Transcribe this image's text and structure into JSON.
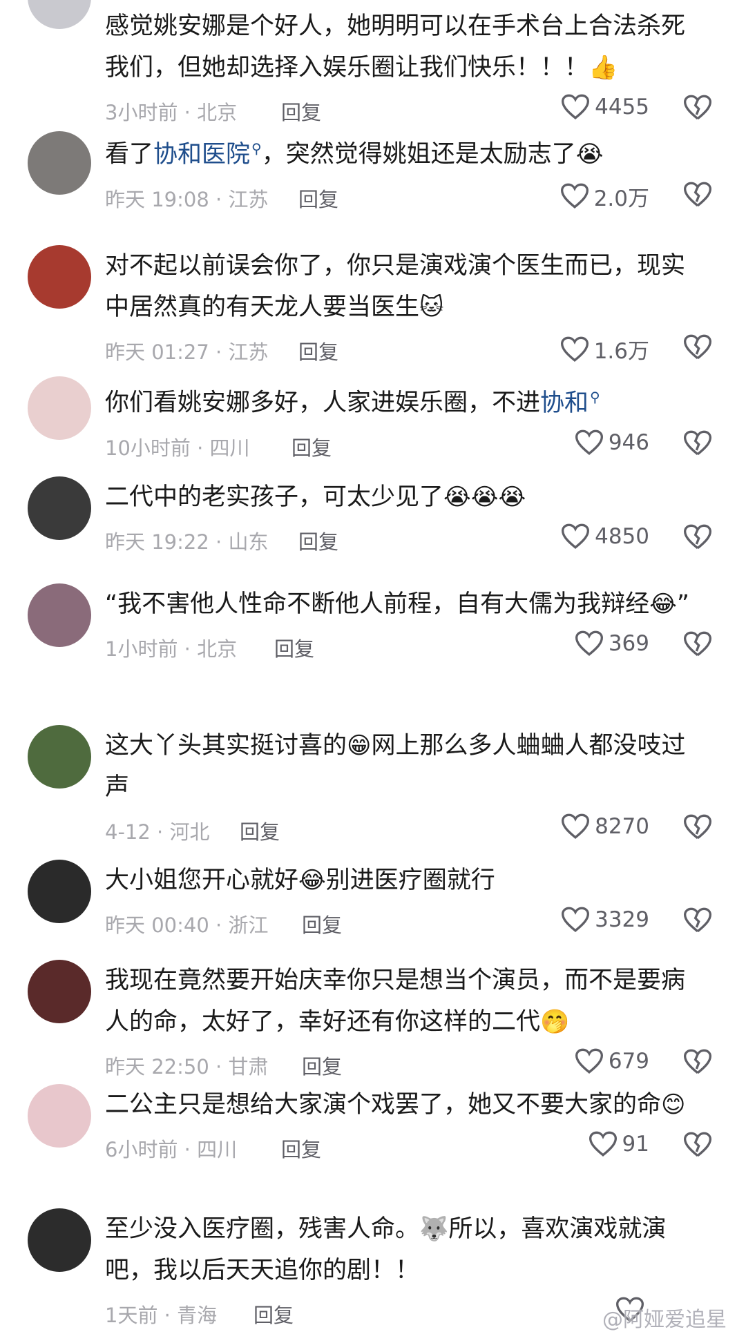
{
  "comments": [
    {
      "text_parts": [
        {
          "t": "感觉姚安娜是个好人，她明明可以在手术台上合法杀死我们，但她却选择入娱乐圈让我们快乐！！！"
        },
        {
          "e": "👍"
        }
      ],
      "time": "3小时前 · 北京",
      "reply": "回复",
      "likes": "4455",
      "avatar_color": "#c9c9cf"
    },
    {
      "text_parts": [
        {
          "t": "看了"
        },
        {
          "k": "协和医院"
        },
        {
          "t": "，突然觉得姚姐还是太励志了"
        },
        {
          "e": "😭"
        }
      ],
      "time": "昨天 19:08 · 江苏",
      "reply": "回复",
      "likes": "2.0万",
      "avatar_color": "#7d7a78"
    },
    {
      "text_parts": [
        {
          "t": "对不起以前误会你了，你只是演戏演个医生而已，现实中居然真的有天龙人要当医生"
        },
        {
          "e": "🐱"
        }
      ],
      "time": "昨天 01:27 · 江苏",
      "reply": "回复",
      "likes": "1.6万",
      "avatar_color": "#a73a2f"
    },
    {
      "text_parts": [
        {
          "t": "你们看姚安娜多好，人家进娱乐圈，不进"
        },
        {
          "k": "协和"
        }
      ],
      "time": "10小时前 · 四川",
      "reply": "回复",
      "likes": "946",
      "avatar_color": "#e9cfcf"
    },
    {
      "text_parts": [
        {
          "t": "二代中的老实孩子，可太少见了"
        },
        {
          "e": "😭😭😭"
        }
      ],
      "time": "昨天 19:22 · 山东",
      "reply": "回复",
      "likes": "4850",
      "avatar_color": "#3a3a3a"
    },
    {
      "text_parts": [
        {
          "t": "“我不害他人性命不断他人前程，自有大儒为我辩经"
        },
        {
          "e": "😂"
        },
        {
          "t": "”"
        }
      ],
      "time": "1小时前 · 北京",
      "reply": "回复",
      "likes": "369",
      "avatar_color": "#8a6b7a"
    },
    {
      "text_parts": [
        {
          "t": "这大丫头其实挺讨喜的"
        },
        {
          "e": "😁"
        },
        {
          "t": "网上那么多人蛐蛐人都没吱过声"
        }
      ],
      "time": "4-12 · 河北",
      "reply": "回复",
      "likes": "8270",
      "avatar_color": "#4f6b3e"
    },
    {
      "text_parts": [
        {
          "t": "大小姐您开心就好"
        },
        {
          "e": "😂"
        },
        {
          "t": "别进医疗圈就行"
        }
      ],
      "time": "昨天 00:40 · 浙江",
      "reply": "回复",
      "likes": "3329",
      "avatar_color": "#2a2a2a"
    },
    {
      "text_parts": [
        {
          "t": "我现在竟然要开始庆幸你只是想当个演员，而不是要病人的命，太好了，幸好还有你这样的二代"
        },
        {
          "e": "🤭"
        }
      ],
      "time": "昨天 22:50 · 甘肃",
      "reply": "回复",
      "likes": "679",
      "avatar_color": "#5a2a2a"
    },
    {
      "text_parts": [
        {
          "t": "二公主只是想给大家演个戏罢了，她又不要大家的命"
        },
        {
          "e": "😊"
        }
      ],
      "time": "6小时前 · 四川",
      "reply": "回复",
      "likes": "91",
      "avatar_color": "#e8c7cc"
    },
    {
      "text_parts": [
        {
          "t": "至少没入医疗圈，残害人命。"
        },
        {
          "e": "🐺"
        },
        {
          "t": "所以，喜欢演戏就演吧，我以后天天追你的剧！！"
        }
      ],
      "time": "1天前 · 青海",
      "reply": "回复",
      "likes": "",
      "avatar_color": "#2c2c2c"
    }
  ],
  "watermark": "@阿娅爱追星"
}
